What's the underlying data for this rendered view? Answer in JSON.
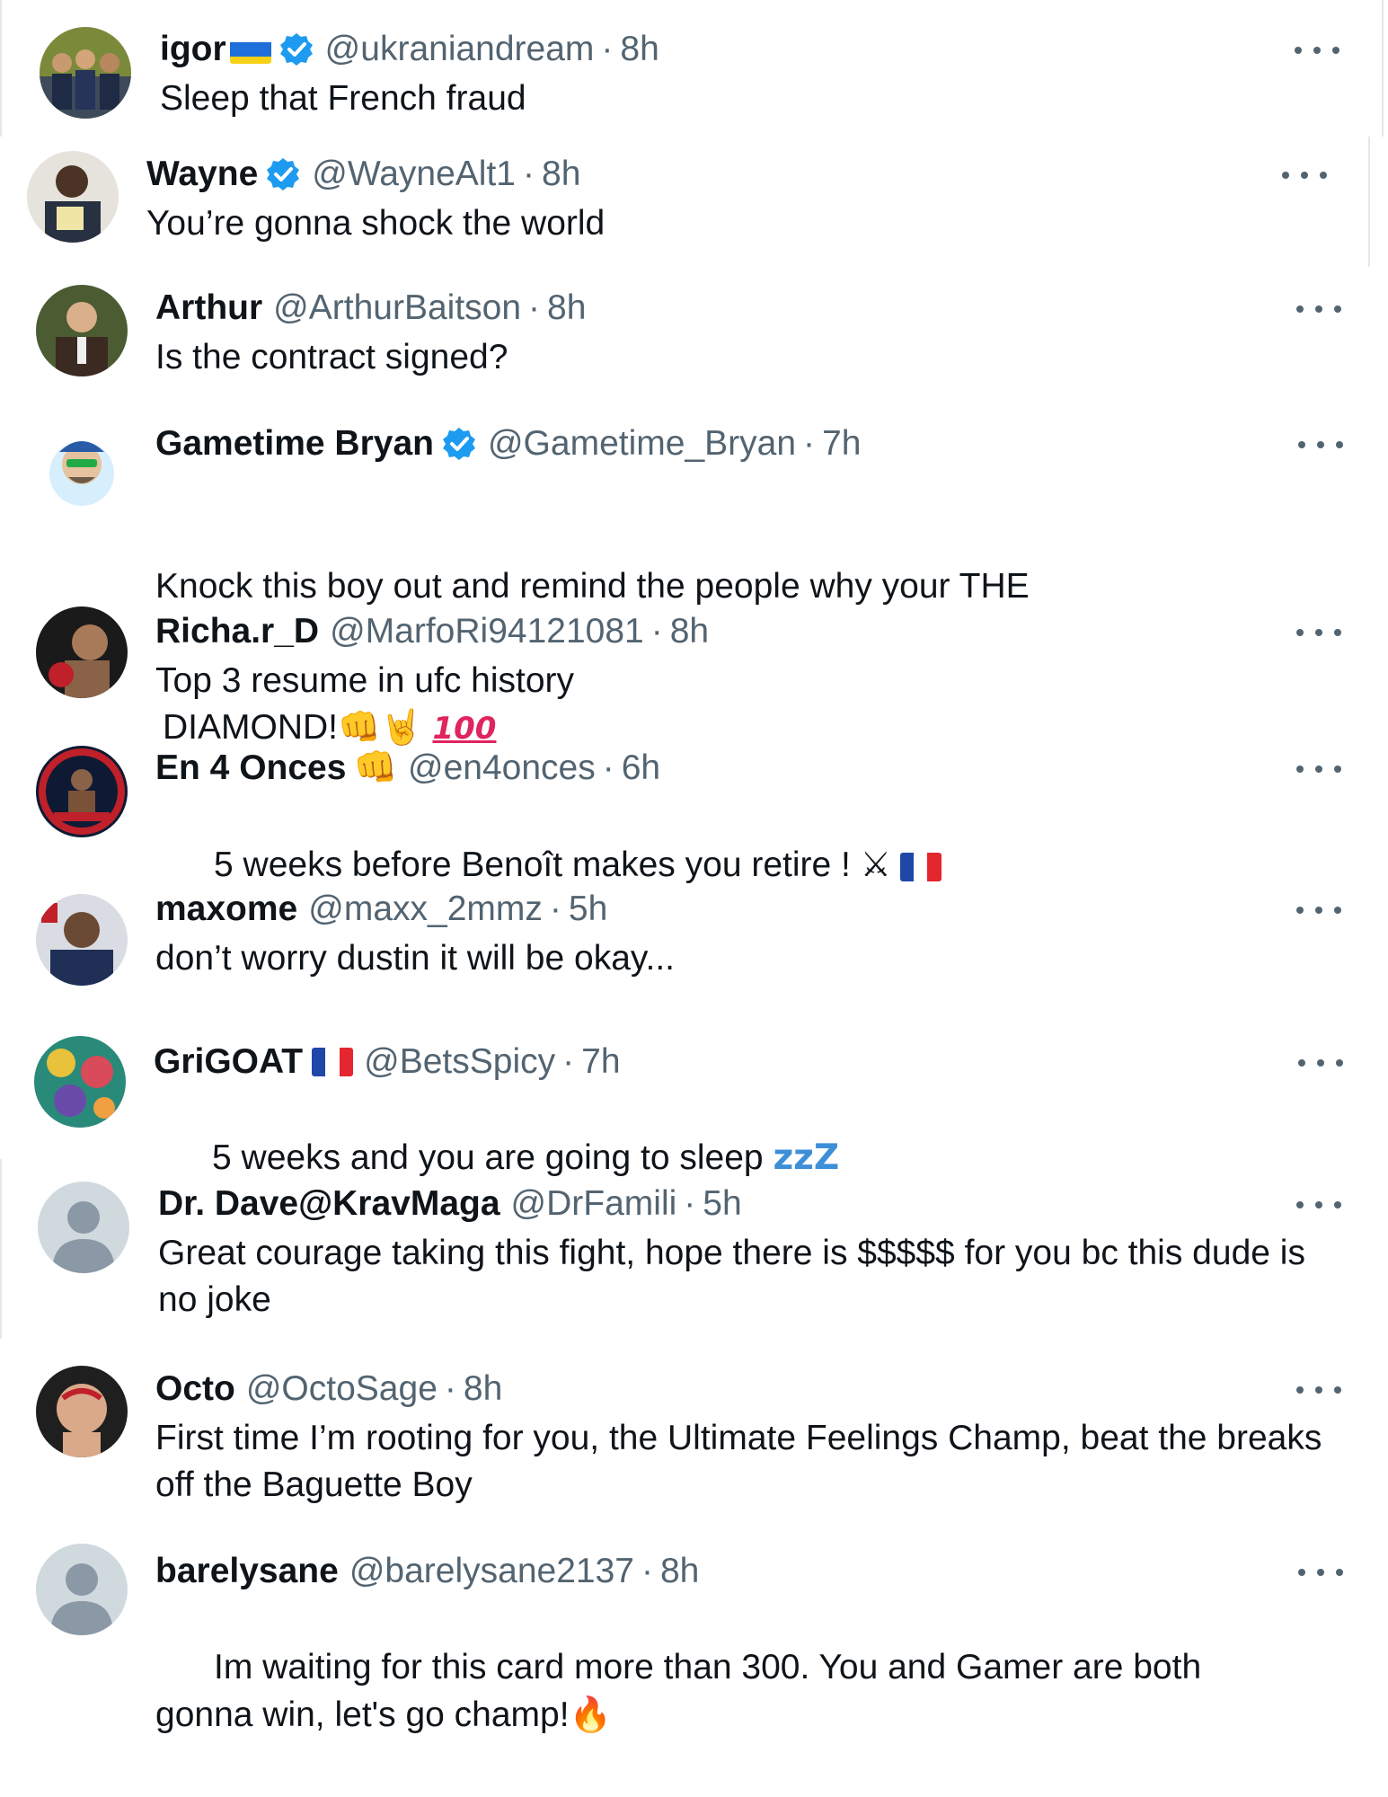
{
  "replies": [
    {
      "name": "igor",
      "name_flag": "ukraine-flag-icon",
      "verified": true,
      "handle": "@ukraniandream",
      "sep": "·",
      "time": "8h",
      "text": "Sleep that French fraud",
      "menu_icon": "more-options-icon"
    },
    {
      "name": "Wayne",
      "verified": true,
      "handle": "@WayneAlt1",
      "sep": "·",
      "time": "8h",
      "text": "You’re gonna shock the world",
      "menu_icon": "more-options-icon"
    },
    {
      "name": "Arthur",
      "verified": false,
      "handle": "@ArthurBaitson",
      "sep": "·",
      "time": "8h",
      "text": "Is the contract signed?",
      "menu_icon": "more-options-icon"
    },
    {
      "name": "Gametime Bryan",
      "verified": true,
      "handle": "@Gametime_Bryan",
      "sep": "·",
      "time": "7h",
      "text_line1": "Knock this boy out and remind the people why your THE",
      "text_line2": "DIAMOND!",
      "text_emoji": "👊🤘",
      "text_emoji_100": "100",
      "menu_icon": "more-options-icon"
    },
    {
      "name": "Richa.r_D",
      "verified": false,
      "handle": "@MarfoRi94121081",
      "sep": "·",
      "time": "8h",
      "text": "Top 3 resume in ufc history",
      "menu_icon": "more-options-icon"
    },
    {
      "name": "En 4 Onces",
      "name_emoji": "👊",
      "verified": false,
      "handle": "@en4onces",
      "sep": "·",
      "time": "6h",
      "text": "5 weeks before Benoît makes you retire !",
      "text_emoji": "⚔",
      "text_flag": "france-flag-icon",
      "menu_icon": "more-options-icon"
    },
    {
      "name": "maxome",
      "verified": false,
      "handle": "@maxx_2mmz",
      "sep": "·",
      "time": "5h",
      "text": "don’t worry dustin it will be okay...",
      "menu_icon": "more-options-icon"
    },
    {
      "name": "GriGOAT",
      "name_flag": "france-flag-icon",
      "verified": false,
      "handle": "@BetsSpicy",
      "sep": "·",
      "time": "7h",
      "text": "5 weeks and you are going to sleep",
      "text_zzz": "zzZ",
      "menu_icon": "more-options-icon"
    },
    {
      "name": "Dr. Dave@KravMaga",
      "verified": false,
      "handle": "@DrFamili",
      "sep": "·",
      "time": "5h",
      "text": "Great courage taking this fight, hope there is $$$$$ for you bc this dude is no joke",
      "menu_icon": "more-options-icon"
    },
    {
      "name": "Octo",
      "verified": false,
      "handle": "@OctoSage",
      "sep": "·",
      "time": "8h",
      "text": "First time I’m rooting for you, the Ultimate Feelings Champ, beat the breaks off the Baguette Boy",
      "menu_icon": "more-options-icon"
    },
    {
      "name": "barelysane",
      "verified": false,
      "handle": "@barelysane2137",
      "sep": "·",
      "time": "8h",
      "text": "Im waiting for this card more than 300. You and Gamer are both gonna win, let's go champ!",
      "text_emoji": "🔥",
      "menu_icon": "more-options-icon"
    }
  ],
  "colors": {
    "text": "#0f1419",
    "secondary": "#536471",
    "verified": "#1d9bf0",
    "background": "#ffffff"
  }
}
